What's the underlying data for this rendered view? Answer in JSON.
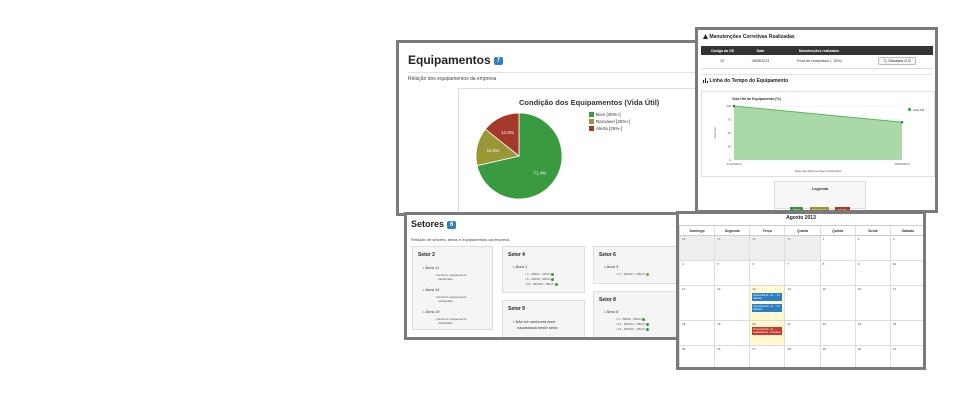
{
  "equipamentos": {
    "title": "Equipamentos",
    "badge": "7",
    "subtitle": "Relação dos equipamentos da empresa",
    "chart_data": {
      "type": "pie",
      "title": "Condição dos Equipamentos (Vida Útil)",
      "slices": [
        {
          "label": "Bom [40%+]",
          "value": 71.4,
          "display": "71.4%",
          "color": "#3a9a3f"
        },
        {
          "label": "Razoável [25%+]",
          "value": 14.3,
          "display": "14.3%",
          "color": "#9a9636"
        },
        {
          "label": "Alerta [25%-]",
          "value": 14.3,
          "display": "14.3%",
          "color": "#a63a2a"
        }
      ]
    }
  },
  "manutencoes": {
    "title": "Manutenções Corretivas Realizadas",
    "columns": [
      "Código da OS",
      "Data",
      "Manutenções realizadas",
      ""
    ],
    "rows": [
      [
        "87",
        "28/08/2013",
        "Troca de compressor (- 30%)",
        "Visualizar O.S."
      ]
    ],
    "timeline_title": "Linha do Tempo do Equipamento",
    "chart_data": {
      "type": "area",
      "title": "Vida Útil do Equipamento (%)",
      "xlabel": "Data das Manutenções Realizadas",
      "ylabel": "Vida Útil",
      "x": [
        "21/10/2012",
        "28/08/2013"
      ],
      "series": [
        {
          "name": "Vida Útil",
          "values": [
            100,
            70
          ]
        }
      ],
      "ylim": [
        0,
        100
      ],
      "yticks": [
        "0",
        "25",
        "50",
        "75",
        "100"
      ],
      "color": "#4caf50"
    },
    "legend_title": "Legenda",
    "legend": [
      {
        "label": "Bom",
        "color": "#3a9a3f"
      },
      {
        "label": "Razoável",
        "color": "#9a9636"
      },
      {
        "label": "Alerta",
        "color": "#a63a2a"
      }
    ]
  },
  "setores": {
    "title": "Setores",
    "badge": "6",
    "subtitle": "Relação de setores, áreas e equipamentos da empresa",
    "s2": {
      "name": "Setor 2",
      "a1": "Área 11",
      "a2": "Área 14",
      "a3": "Área 19",
      "none1": "Nenhum equipamento",
      "none2": "cadastrado"
    },
    "s4": {
      "name": "Setor 4",
      "a1": "Área 1",
      "e1": "4 - 00004 - ABCD",
      "e2": "8 - 00008 - ABCD",
      "e3": "15 - 000015 - ABCD"
    },
    "s6": {
      "name": "Setor 6",
      "a1": "Área 3",
      "e1": "17 - 000017 - ABCD"
    },
    "s9": {
      "name": "Setor 9",
      "msg1": "Não há nenhuma área",
      "msg2": "cadastrada neste setor."
    },
    "s8": {
      "name": "Setor 8",
      "a1": "Área 6",
      "e1": "9 - 00009 - ABCD",
      "e2": "14 - 000014 - ABCD",
      "e3": "16 - 000016 - ABCD"
    }
  },
  "calendar": {
    "title": "Agosto 2013",
    "days": [
      "Domingo",
      "Segunda",
      "Terça",
      "Quarta",
      "Quinta",
      "Sexta",
      "Sábado"
    ],
    "weeks": [
      [
        "28",
        "29",
        "30",
        "31",
        "1",
        "2",
        "3"
      ],
      [
        "4",
        "5",
        "6",
        "7",
        "8",
        "9",
        "10"
      ],
      [
        "11",
        "12",
        "13",
        "14",
        "15",
        "16",
        "17"
      ],
      [
        "18",
        "19",
        "20",
        "21",
        "22",
        "23",
        "24"
      ],
      [
        "25",
        "26",
        "27",
        "28",
        "29",
        "30",
        "31"
      ]
    ],
    "events": [
      {
        "text": "Preventiva 01 - Ar ... 'Ar' Manual",
        "color": "#2a7fc6"
      },
      {
        "text": "Preventiva 02 - Ar ... 'Ar' Manual",
        "color": "#2a7fc6"
      },
      {
        "text": "Preventiva 03 - Ar ... Equipamento - Corretiva",
        "color": "#c23b2b"
      }
    ]
  }
}
